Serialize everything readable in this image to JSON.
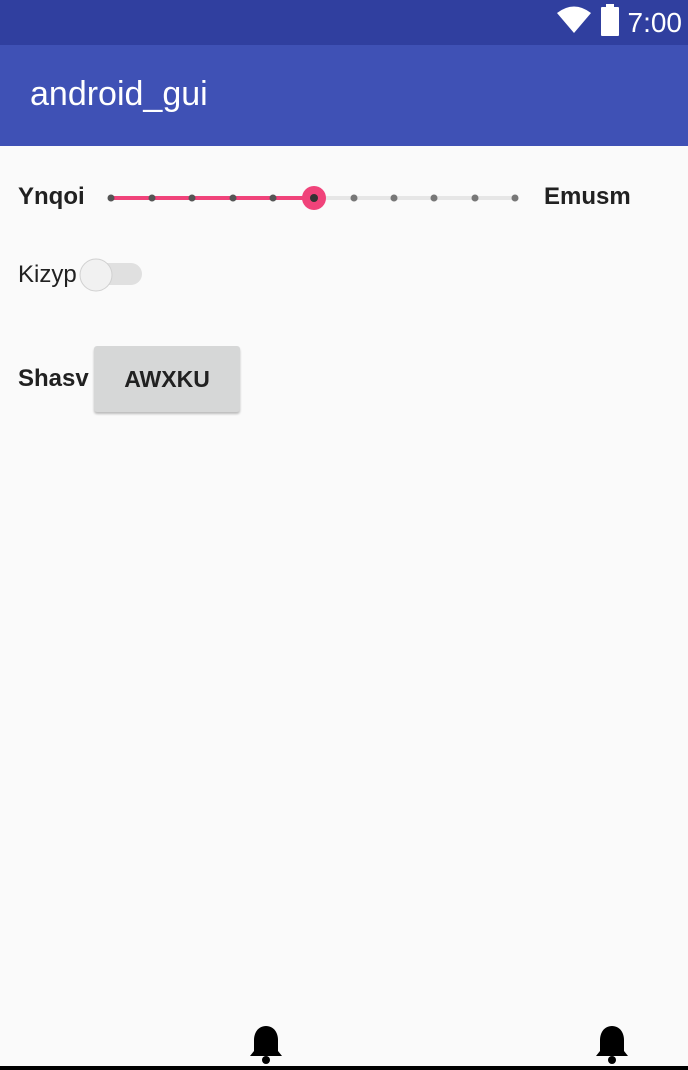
{
  "status_bar": {
    "time": "7:00",
    "icons": [
      "wifi-icon",
      "battery-icon"
    ]
  },
  "app_bar": {
    "title": "android_gui"
  },
  "slider_row": {
    "left_label": "Ynqoi",
    "right_label": "Emusm",
    "value": 5,
    "max": 10,
    "accent": "#f0437a"
  },
  "switch_row": {
    "label": "Kizyp",
    "checked": false
  },
  "button_row": {
    "label": "Shasv",
    "button_text": "AWXKU"
  },
  "bottom_icons": [
    "bell-icon",
    "bell-icon"
  ]
}
